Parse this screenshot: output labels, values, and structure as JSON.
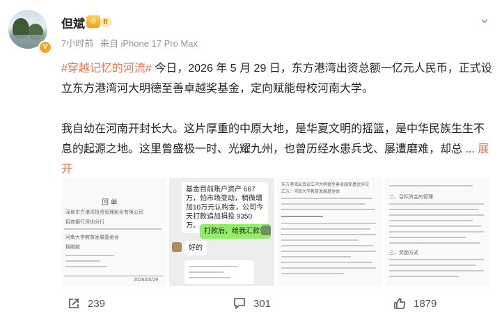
{
  "user": {
    "name": "但斌",
    "level_badge": "Ⅱ",
    "level_icon": "♔",
    "verified_mark": "V",
    "meta": {
      "time": "7小时前",
      "source": "来自 iPhone 17 Pro Max"
    }
  },
  "post": {
    "hashtag": "#穿越记忆的河流#",
    "para1": " 今日，2026 年 5 月 29 日，东方港湾出资总额一亿元人民币，正式设立东方港湾河大明德至善卓越奖基金，定向赋能母校河南大学。",
    "para2": "我自幼在河南开封长大。这片厚重的中原大地，是华夏文明的摇篮，是中华民族生生不息的起源之地。这里曾盛极一时、光耀九州，也曾历经水患兵戈、屡遭磨难，却总",
    "ellipsis": " ... ",
    "expand_label": "展开"
  },
  "images": {
    "receipt": {
      "title": "回 单",
      "line1": "深圳东方港湾投资管理股份有限公司",
      "line2": "招商银行深圳分行",
      "line3": "河南大学教育发展基金会",
      "line4": "捐赠款",
      "serial": "2026/05/29"
    },
    "chat": {
      "msg1": "基金目前账户资产 667万，怕市场变动，稍微增加10万元认购金，公司今天打款追加捐投 9350万。",
      "msg2": "打款后，给我汇款单",
      "msg3": "好的"
    },
    "contract": {
      "title": "东方港湾出资设立河大明德至善卓越奖基金协议",
      "party_b": "乙方：河南大学教育发展基金会"
    },
    "appendix": {
      "title": "二、目标资金的管理",
      "section": "三、奖励方式"
    }
  },
  "actions": {
    "share_count": "239",
    "comment_count": "301",
    "like_count": "1879"
  },
  "colors": {
    "accent": "#eb7350",
    "meta": "#939393",
    "wechat_green": "#95ec69"
  }
}
